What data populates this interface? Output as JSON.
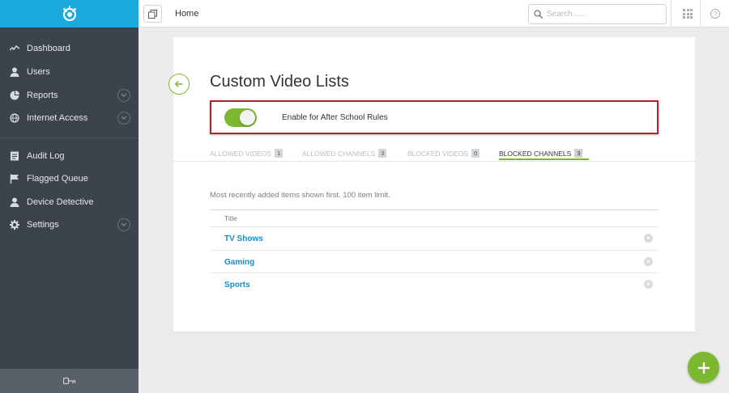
{
  "sidebar": {
    "items": [
      {
        "label": "Dashboard",
        "icon": "activity-icon"
      },
      {
        "label": "Users",
        "icon": "user-icon"
      },
      {
        "label": "Reports",
        "icon": "pie-chart-icon",
        "expandable": true
      },
      {
        "label": "Internet Access",
        "icon": "globe-icon",
        "expandable": true
      },
      {
        "label": "Audit Log",
        "icon": "list-icon"
      },
      {
        "label": "Flagged Queue",
        "icon": "flag-icon"
      },
      {
        "label": "Device Detective",
        "icon": "user-icon"
      },
      {
        "label": "Settings",
        "icon": "gear-icon",
        "expandable": true
      }
    ]
  },
  "topbar": {
    "breadcrumb": "Home",
    "search_placeholder": "Search......"
  },
  "page": {
    "title": "Custom Video Lists",
    "toggle": {
      "label": "Enable for After School Rules",
      "enabled": true
    },
    "tabs": [
      {
        "label": "ALLOWED VIDEOS",
        "count": "1",
        "active": false
      },
      {
        "label": "ALLOWED CHANNELS",
        "count": "3",
        "active": false
      },
      {
        "label": "BLOCKED VIDEOS",
        "count": "0",
        "active": false
      },
      {
        "label": "BLOCKED CHANNELS",
        "count": "3",
        "active": true
      }
    ],
    "note": "Most recently added items shown first. 100 item limit.",
    "table": {
      "header": "Title",
      "rows": [
        "TV Shows",
        "Gaming",
        "Sports"
      ]
    }
  },
  "colors": {
    "brand": "#1ba8dd",
    "accent": "#7cb82f",
    "sidebar": "#3d434b",
    "link": "#1a8ac9",
    "highlight_frame": "#b32128"
  }
}
